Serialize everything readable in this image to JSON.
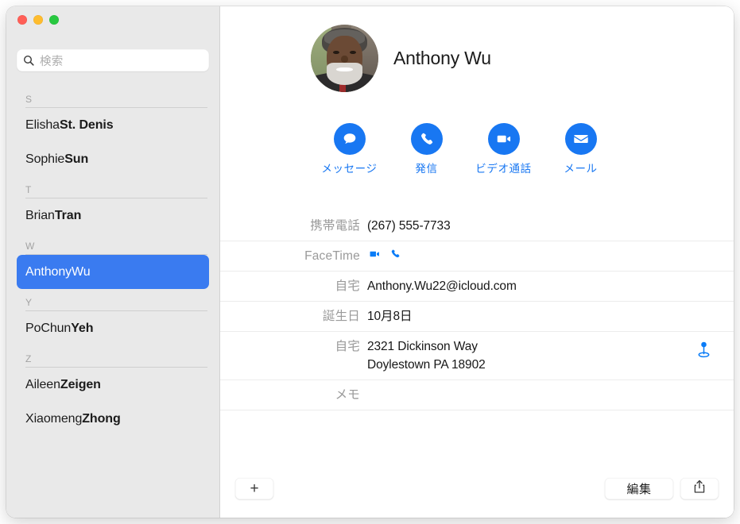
{
  "window": {
    "traffic_lights": [
      {
        "name": "close",
        "color": "#ff5f57"
      },
      {
        "name": "minimize",
        "color": "#febc2e"
      },
      {
        "name": "zoom",
        "color": "#28c840"
      }
    ]
  },
  "sidebar": {
    "search": {
      "icon": "search-icon",
      "placeholder": "検索",
      "value": ""
    },
    "sections": [
      {
        "letter": "S",
        "contacts": [
          {
            "first": "Elisha ",
            "last": "St. Denis",
            "selected": false
          },
          {
            "first": "Sophie ",
            "last": "Sun",
            "selected": false
          }
        ]
      },
      {
        "letter": "T",
        "contacts": [
          {
            "first": "Brian ",
            "last": "Tran",
            "selected": false
          }
        ]
      },
      {
        "letter": "W",
        "contacts": [
          {
            "first": "Anthony ",
            "last": "Wu",
            "selected": true
          }
        ]
      },
      {
        "letter": "Y",
        "contacts": [
          {
            "first": "PoChun ",
            "last": "Yeh",
            "selected": false
          }
        ]
      },
      {
        "letter": "Z",
        "contacts": [
          {
            "first": "Aileen ",
            "last": "Zeigen",
            "selected": false
          },
          {
            "first": "Xiaomeng ",
            "last": "Zhong",
            "selected": false
          }
        ]
      }
    ]
  },
  "detail": {
    "avatar": "contact-photo",
    "name": "Anthony Wu",
    "actions": [
      {
        "label": "メッセージ",
        "icon": "message-bubble-icon",
        "name": "message-action"
      },
      {
        "label": "発信",
        "icon": "phone-icon",
        "name": "call-action"
      },
      {
        "label": "ビデオ通話",
        "icon": "video-camera-icon",
        "name": "video-call-action"
      },
      {
        "label": "メール",
        "icon": "envelope-icon",
        "name": "mail-action"
      }
    ],
    "fields": [
      {
        "label": "携帯電話",
        "type": "text",
        "value": "(267) 555-7733",
        "name": "mobile-phone"
      },
      {
        "label": "FaceTime",
        "type": "icons",
        "value": "",
        "name": "facetime"
      },
      {
        "label": "自宅",
        "type": "text",
        "value": "Anthony.Wu22@icloud.com",
        "name": "home-email"
      },
      {
        "label": "誕生日",
        "type": "text",
        "value": "10月8日",
        "name": "birthday"
      },
      {
        "label": "自宅",
        "type": "address",
        "line1": "2321 Dickinson Way",
        "line2": "Doylestown PA 18902",
        "name": "home-address"
      },
      {
        "label": "メモ",
        "type": "text",
        "value": "",
        "name": "notes"
      }
    ]
  },
  "bottom_bar": {
    "add_label": "+",
    "edit_label": "編集",
    "share_icon": "share-icon"
  },
  "colors": {
    "accent_blue": "#1877f2",
    "selection_blue": "#3a7bf0",
    "sidebar_bg": "#e9e9e9",
    "label_gray": "#9a9a9a"
  }
}
